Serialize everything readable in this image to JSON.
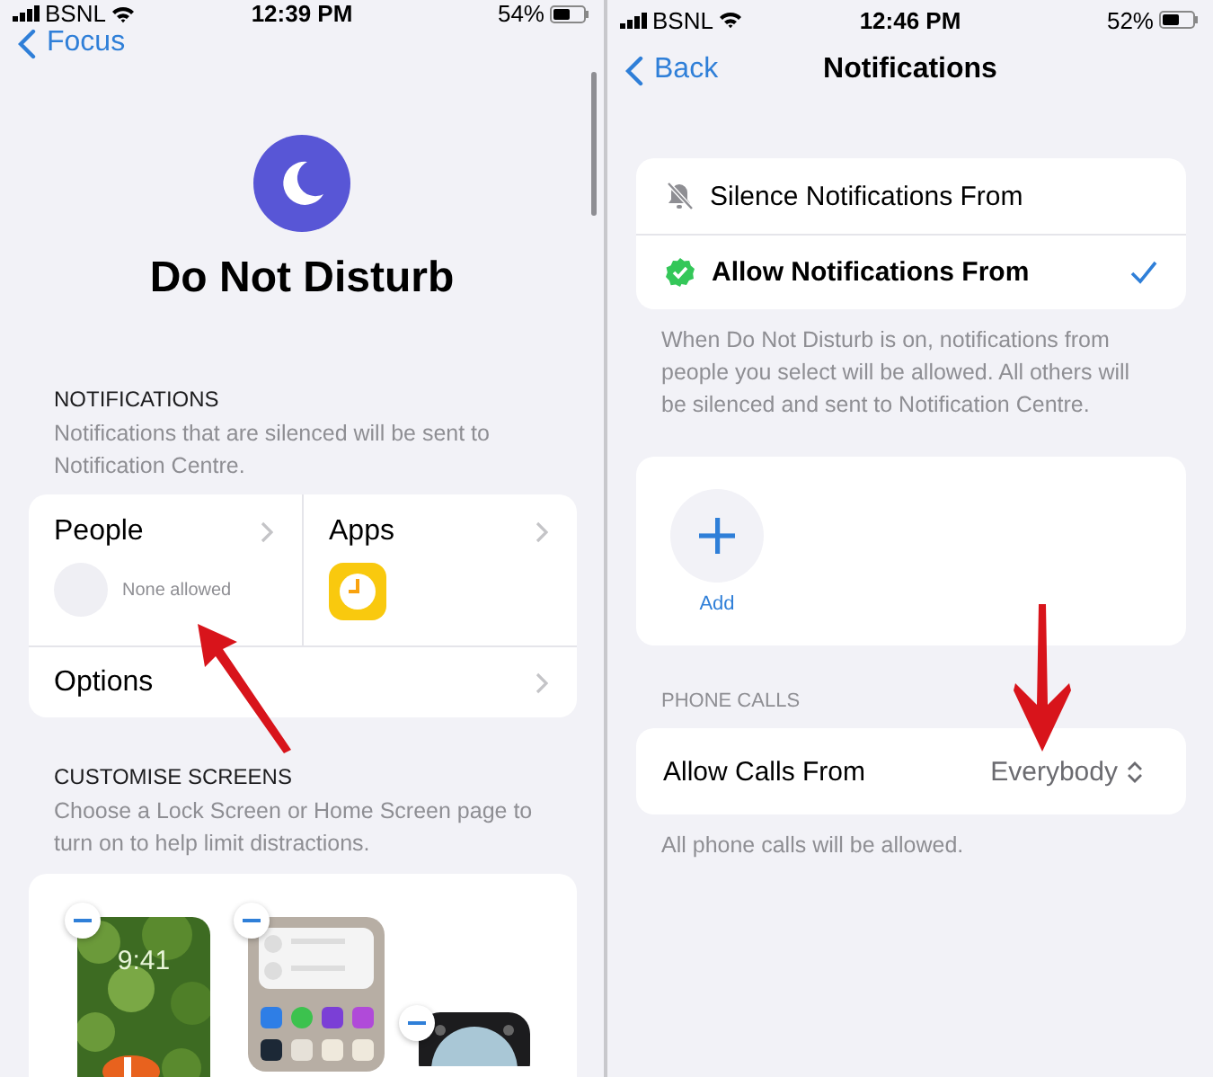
{
  "left": {
    "status_bar": {
      "carrier": "BSNL",
      "time": "12:39 PM",
      "battery": "54%"
    },
    "nav": {
      "back": "Focus"
    },
    "title": "Do Not Disturb",
    "notifications": {
      "header": "NOTIFICATIONS",
      "description": "Notifications that are silenced will be sent to Notification Centre.",
      "people": {
        "label": "People",
        "status": "None allowed"
      },
      "apps": {
        "label": "Apps"
      },
      "options": {
        "label": "Options"
      }
    },
    "customise": {
      "header": "CUSTOMISE SCREENS",
      "description": "Choose a Lock Screen or Home Screen page to turn on to help limit distractions.",
      "lock_time": "9:41"
    }
  },
  "right": {
    "status_bar": {
      "carrier": "BSNL",
      "time": "12:46 PM",
      "battery": "52%"
    },
    "nav": {
      "back": "Back",
      "title": "Notifications"
    },
    "modes": [
      {
        "kind": "silence",
        "label": "Silence Notifications From",
        "selected": false
      },
      {
        "kind": "allow",
        "label": "Allow Notifications From",
        "selected": true
      }
    ],
    "modes_footer": "When Do Not Disturb is on, notifications from people you select will be allowed. All others will be silenced and sent to Notification Centre.",
    "add_label": "Add",
    "phone_calls": {
      "header": "PHONE CALLS",
      "label": "Allow Calls From",
      "value": "Everybody",
      "footer": "All phone calls will be allowed."
    }
  }
}
